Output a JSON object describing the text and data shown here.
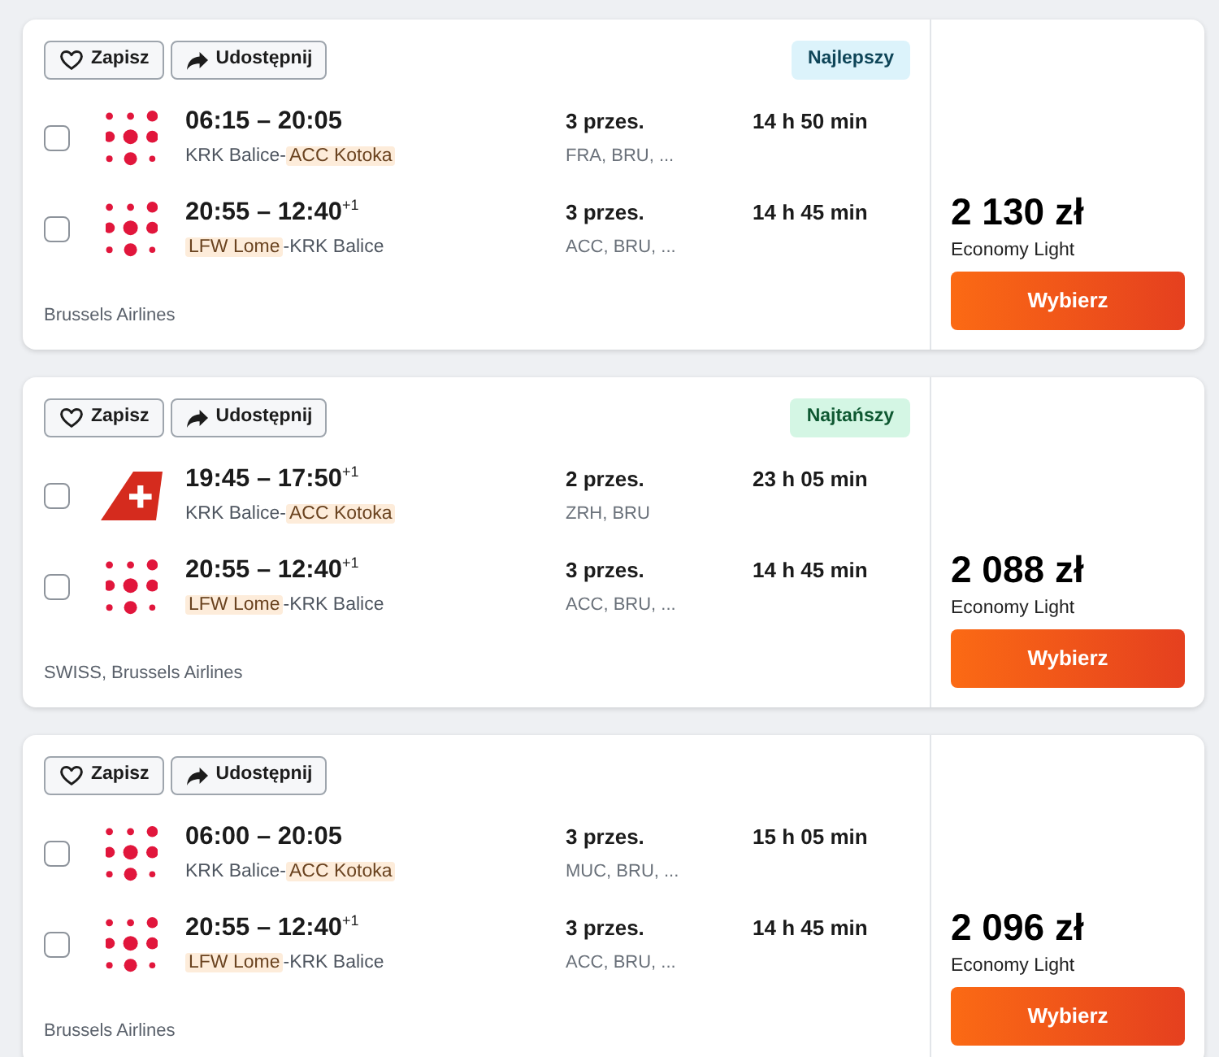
{
  "results": [
    {
      "actions": [
        {
          "label": "Zapisz",
          "kind": "save"
        },
        {
          "label": "Udostępnij",
          "kind": "share"
        }
      ],
      "badge": {
        "label": "Najlepszy",
        "color": "#dcf3fb"
      },
      "legs": [
        {
          "checked": false,
          "logo": {
            "kind": "dots"
          },
          "times": "06:15 – 20:05",
          "route": [
            {
              "text": "KRK Balice-",
              "highlighted": false
            },
            {
              "text": "ACC Kotoka",
              "highlighted": true
            }
          ],
          "stops": "3 przes.",
          "via": "FRA, BRU, ...",
          "duration": "14 h 50 min"
        },
        {
          "checked": false,
          "logo": {
            "kind": "dots"
          },
          "times": "20:55 – 12:40$^{+1}$",
          "route": [
            {
              "text": "LFW Lome",
              "highlighted": true
            },
            {
              "text": "-KRK Balice",
              "highlighted": false
            }
          ],
          "stops": "3 przes.",
          "via": "ACC, BRU, ...",
          "duration": "14 h 45 min"
        }
      ],
      "airlines": "Brussels Airlines",
      "price": "2 130 zł",
      "fare": "Economy Light",
      "select_button": "Wybierz"
    },
    {
      "actions": [
        {
          "label": "Zapisz",
          "kind": "save"
        },
        {
          "label": "Udostępnij",
          "kind": "share"
        }
      ],
      "badge": {
        "label": "Najtańszy",
        "color": "#d4f6e4"
      },
      "legs": [
        {
          "checked": false,
          "logo": {
            "kind": "tail"
          },
          "times": "19:45 – 17:50$^{+1}$",
          "route": [
            {
              "text": "KRK Balice-",
              "highlighted": false
            },
            {
              "text": "ACC Kotoka",
              "highlighted": true
            }
          ],
          "stops": "2 przes.",
          "via": "ZRH, BRU",
          "duration": "23 h 05 min"
        },
        {
          "checked": false,
          "logo": {
            "kind": "dots"
          },
          "times": "20:55 – 12:40$^{+1}$",
          "route": [
            {
              "text": "LFW Lome",
              "highlighted": true
            },
            {
              "text": "-KRK Balice",
              "highlighted": false
            }
          ],
          "stops": "3 przes.",
          "via": "ACC, BRU, ...",
          "duration": "14 h 45 min"
        }
      ],
      "airlines": "SWISS, Brussels Airlines",
      "price": "2 088 zł",
      "fare": "Economy Light",
      "select_button": "Wybierz"
    },
    {
      "actions": [
        {
          "label": "Zapisz",
          "kind": "save"
        },
        {
          "label": "Udostępnij",
          "kind": "share"
        }
      ],
      "legs": [
        {
          "checked": false,
          "logo": {
            "kind": "dots"
          },
          "times": "06:00 – 20:05",
          "route": [
            {
              "text": "KRK Balice-",
              "highlighted": false
            },
            {
              "text": "ACC Kotoka",
              "highlighted": true
            }
          ],
          "stops": "3 przes.",
          "via": "MUC, BRU, ...",
          "duration": "15 h 05 min"
        },
        {
          "checked": false,
          "logo": {
            "kind": "dots"
          },
          "times": "20:55 – 12:40$^{+1}$",
          "route": [
            {
              "text": "LFW Lome",
              "highlighted": true
            },
            {
              "text": "-KRK Balice",
              "highlighted": false
            }
          ],
          "stops": "3 przes.",
          "via": "ACC, BRU, ...",
          "duration": "14 h 45 min"
        }
      ],
      "airlines": "Brussels Airlines",
      "price": "2 096 zł",
      "fare": "Economy Light",
      "select_button": "Wybierz"
    }
  ]
}
